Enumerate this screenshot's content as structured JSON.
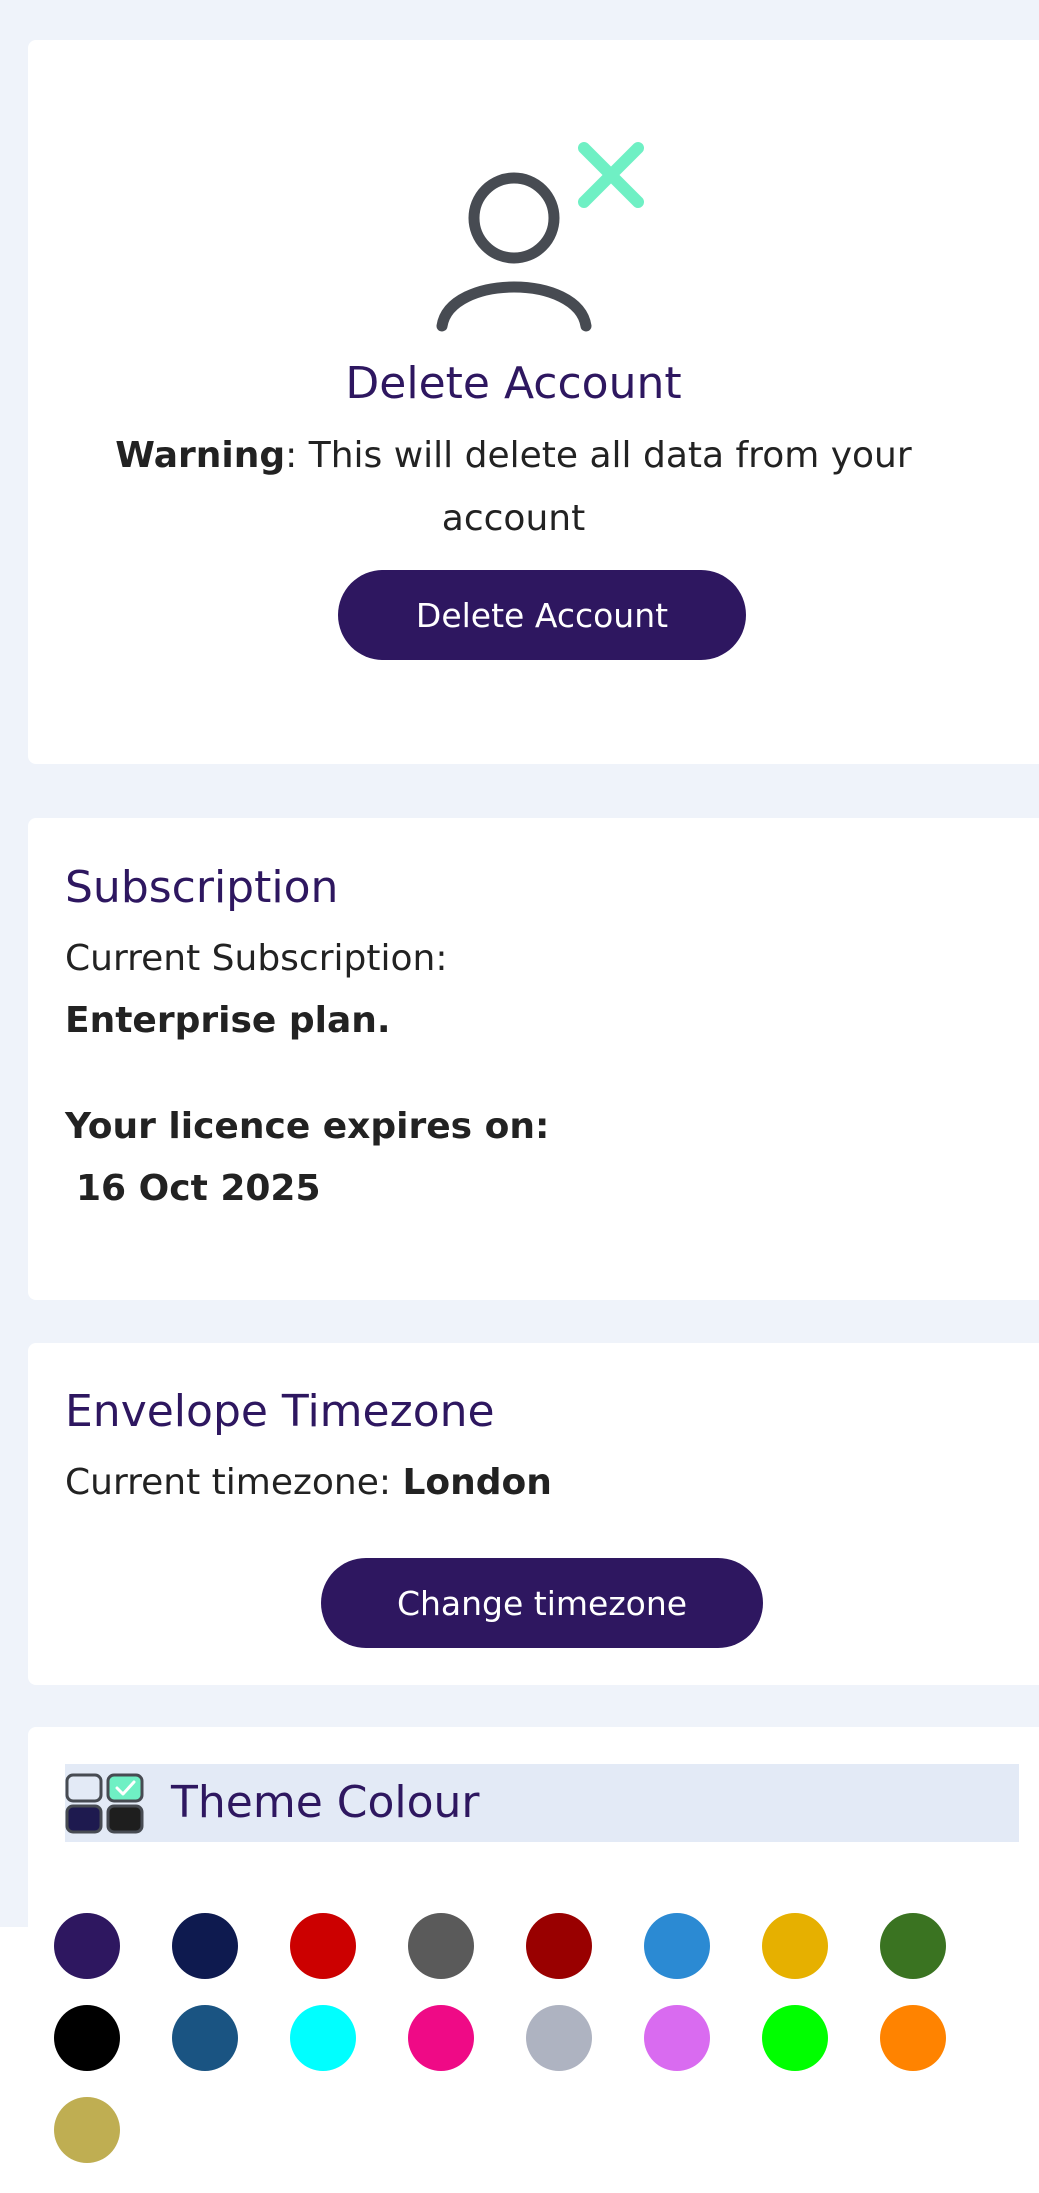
{
  "delete_card": {
    "icon": "user-remove-icon",
    "title": "Delete Account",
    "warning_label": "Warning",
    "warning_text": ": This will delete all data from your account",
    "button_label": "Delete Account"
  },
  "subscription": {
    "title": "Subscription",
    "current_label": "Current Subscription:",
    "plan": "Enterprise plan.",
    "licence_label": "Your licence expires on:",
    "licence_date": "16 Oct 2025"
  },
  "timezone": {
    "title": "Envelope Timezone",
    "current_label": "Current timezone: ",
    "current_value": "London",
    "button_label": "Change timezone"
  },
  "theme": {
    "icon": "theme-grid-icon",
    "title": "Theme Colour",
    "colors": [
      "#2e1760",
      "#0e1a4f",
      "#cc0000",
      "#5a5a5a",
      "#990000",
      "#2b8ad3",
      "#e6b000",
      "#3a7321",
      "#000000",
      "#1a5482",
      "#00ffff",
      "#ef0a86",
      "#aeb3c1",
      "#d96bf0",
      "#00ff00",
      "#ff8300",
      "#bfae52"
    ]
  }
}
